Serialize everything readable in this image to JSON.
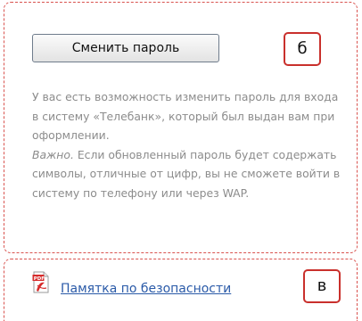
{
  "password": {
    "change_button_label": "Сменить пароль",
    "description_1": "У вас есть возможность изменить пароль для входа в систему «Телебанк», который был выдан вам при оформлении.",
    "important_label": "Важно.",
    "description_2": " Если обновленный пароль будет содержать символы, отличные от цифр, вы не сможете войти в систему по телефону или через WAP."
  },
  "security": {
    "memo_link_label": "Памятка по безопасности",
    "icon": "pdf-icon"
  },
  "markers": {
    "b": "б",
    "c": "в"
  },
  "colors": {
    "dashed_border": "#d9534f",
    "marker_border": "#c9302c",
    "description_text": "#8c8c8c",
    "link": "#2a5aa8"
  }
}
